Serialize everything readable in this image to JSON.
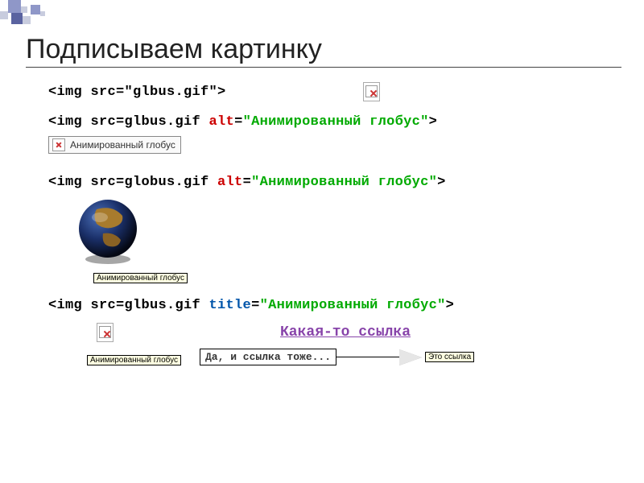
{
  "title": "Подписываем картинку",
  "code1": {
    "pre": "<img src=\"glbus.gif\">"
  },
  "code2": {
    "pre": "<img src=glbus.gif ",
    "attr": "alt",
    "mid": "=",
    "val": "\"Анимированный глобус\"",
    "post": ">"
  },
  "alt_box2": "Анимированный глобус",
  "code3": {
    "pre": "<img src=globus.gif ",
    "attr": "alt",
    "mid": "=",
    "val": "\"Анимированный глобус\"",
    "post": ">"
  },
  "globe_label": "Анимированный глобус",
  "code4": {
    "pre": "<img src=glbus.gif ",
    "attr": "title",
    "mid": "=",
    "val": "\"Анимированный глобус\"",
    "post": ">"
  },
  "link_text": "Какая-то ссылка",
  "tooltip1": "Анимированный глобус",
  "tooltip2": "Да, и ссылка тоже...",
  "tooltip3": "Это ссылка"
}
